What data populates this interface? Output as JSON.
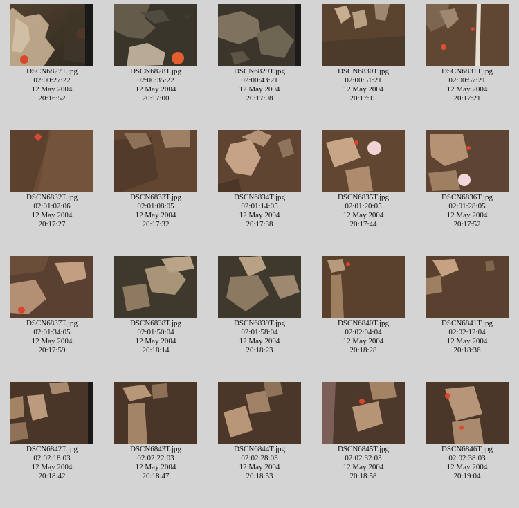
{
  "gallery": {
    "items": [
      {
        "filename": "DSCN6827T.jpg",
        "offset": "02:00:27:22",
        "date": "12 May 2004",
        "time": "20:16:52",
        "palette": "dark-rocky-with-red"
      },
      {
        "filename": "DSCN6828T.jpg",
        "offset": "02:00:35:22",
        "date": "12 May 2004",
        "time": "20:17:00",
        "palette": "dark-rocky-with-red"
      },
      {
        "filename": "DSCN6829T.jpg",
        "offset": "02:00:43:21",
        "date": "12 May 2004",
        "time": "20:17:08",
        "palette": "dark-rocky"
      },
      {
        "filename": "DSCN6830T.jpg",
        "offset": "02:00:51:21",
        "date": "12 May 2004",
        "time": "20:17:15",
        "palette": "brown-rocky"
      },
      {
        "filename": "DSCN6831T.jpg",
        "offset": "02:00:57:21",
        "date": "12 May 2004",
        "time": "20:17:21",
        "palette": "brown-rocky-with-red"
      },
      {
        "filename": "DSCN6832T.jpg",
        "offset": "02:01:02:06",
        "date": "12 May 2004",
        "time": "20:17:27",
        "palette": "brown-sediment"
      },
      {
        "filename": "DSCN6833T.jpg",
        "offset": "02:01:08:05",
        "date": "12 May 2004",
        "time": "20:17:32",
        "palette": "brown-sediment"
      },
      {
        "filename": "DSCN6834T.jpg",
        "offset": "02:01:14:05",
        "date": "12 May 2004",
        "time": "20:17:38",
        "palette": "brown-rocky"
      },
      {
        "filename": "DSCN6835T.jpg",
        "offset": "02:01:20:05",
        "date": "12 May 2004",
        "time": "20:17:44",
        "palette": "brown-rocky-with-pink"
      },
      {
        "filename": "DSCN6836T.jpg",
        "offset": "02:01:28:05",
        "date": "12 May 2004",
        "time": "20:17:52",
        "palette": "brown-rocky-with-pink"
      },
      {
        "filename": "DSCN6837T.jpg",
        "offset": "02:01:34:05",
        "date": "12 May 2004",
        "time": "20:17:59",
        "palette": "brown-rocky-with-red"
      },
      {
        "filename": "DSCN6838T.jpg",
        "offset": "02:01:50:04",
        "date": "12 May 2004",
        "time": "20:18:14",
        "palette": "dark-rocky"
      },
      {
        "filename": "DSCN6839T.jpg",
        "offset": "02:01:58:04",
        "date": "12 May 2004",
        "time": "20:18:23",
        "palette": "dark-rocky"
      },
      {
        "filename": "DSCN6840T.jpg",
        "offset": "02:02:04:04",
        "date": "12 May 2004",
        "time": "20:18:28",
        "palette": "brown-sediment-with-rock"
      },
      {
        "filename": "DSCN6841T.jpg",
        "offset": "02:02:12:04",
        "date": "12 May 2004",
        "time": "20:18:36",
        "palette": "brown-sediment-with-rock"
      },
      {
        "filename": "DSCN6842T.jpg",
        "offset": "02:02:18:03",
        "date": "12 May 2004",
        "time": "20:18:42",
        "palette": "dark-sediment-with-rock"
      },
      {
        "filename": "DSCN6843T.jpg",
        "offset": "02:02:22:03",
        "date": "12 May 2004",
        "time": "20:18:47",
        "palette": "dark-sediment-with-rock"
      },
      {
        "filename": "DSCN6844T.jpg",
        "offset": "02:02:28:03",
        "date": "12 May 2004",
        "time": "20:18:53",
        "palette": "dark-sediment-with-rock"
      },
      {
        "filename": "DSCN6845T.jpg",
        "offset": "02:02:32:03",
        "date": "12 May 2004",
        "time": "20:18:58",
        "palette": "dark-sediment-with-pink"
      },
      {
        "filename": "DSCN6846T.jpg",
        "offset": "02:02:38:03",
        "date": "12 May 2004",
        "time": "20:19:04",
        "palette": "dark-sediment-with-red"
      }
    ]
  }
}
